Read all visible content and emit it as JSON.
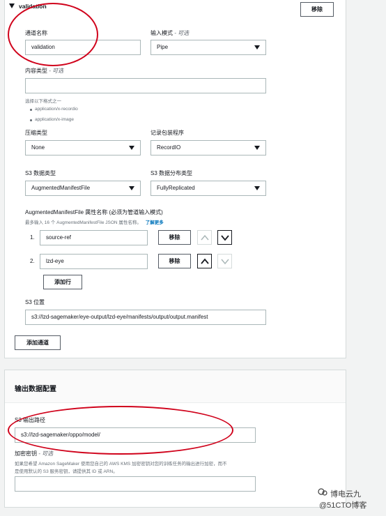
{
  "channel": {
    "section_title": "validation",
    "remove_label": "移除",
    "name_label": "通道名称",
    "name_value": "validation",
    "input_mode_label": "输入模式",
    "input_mode_optional": "- 可选",
    "input_mode_value": "Pipe",
    "content_type_label": "内容类型",
    "content_type_optional": "- 可选",
    "content_type_value": "",
    "content_type_hint": "选择以下格式之一",
    "content_type_options": [
      "application/x-recordio",
      "application/x-image"
    ],
    "compression_label": "压缩类型",
    "compression_value": "None",
    "record_wrapper_label": "记录包装程序",
    "record_wrapper_value": "RecordIO",
    "s3_data_type_label": "S3 数据类型",
    "s3_data_type_value": "AugmentedManifestFile",
    "s3_distribution_label": "S3 数据分布类型",
    "s3_distribution_value": "FullyReplicated",
    "attr_names_label": "AugmentedManifestFile 属性名称 (必须为管道输入模式)",
    "attr_names_hint": "最多输入 16 个 AugmentedManifestFile JSON 属性名称。",
    "learn_more": "了解更多",
    "attributes": [
      {
        "index": "1.",
        "value": "source-ref",
        "remove": "移除"
      },
      {
        "index": "2.",
        "value": "lzd-eye",
        "remove": "移除"
      }
    ],
    "add_row_label": "添加行",
    "s3_location_label": "S3 位置",
    "s3_location_value": "s3://lzd-sagemaker/eye-output/lzd-eye/manifests/output/output.manifest",
    "add_channel_label": "添加通道"
  },
  "output": {
    "section_title": "输出数据配置",
    "s3_output_label": "S3 输出路径",
    "s3_output_value": "s3://lzd-sagemaker/oppo/model/",
    "encryption_label": "加密密钥",
    "encryption_optional": "- 可选",
    "encryption_hint_1": "如果您希望 Amazon SageMaker 使用您自己的 AWS KMS 加密密钥对您的训练任务的输出进行加密，而不",
    "encryption_hint_2": "是使用默认的 S3 服务密钥，请提供其 ID 或 ARN。",
    "encryption_value": ""
  },
  "watermark": {
    "line1": "博电云九",
    "line2": "@51CTO博客"
  },
  "colors": {
    "annotation": "#d0021b",
    "link": "#0073bb",
    "border": "#aab7b8",
    "text": "#16191f"
  }
}
